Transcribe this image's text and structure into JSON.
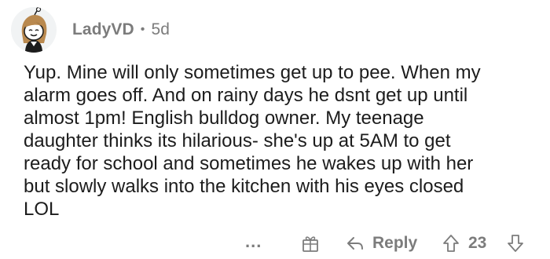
{
  "comment": {
    "author": "LadyVD",
    "separator": "•",
    "age": "5d",
    "body_lines": [
      "Yup. Mine will only sometimes get up to pee. When my",
      "alarm goes off. And on rainy days he dsnt get up until",
      "almost 1pm! English bulldog owner. My teenage",
      "daughter thinks its hilarious- she's up at 5AM to get",
      "ready for school and sometimes he wakes up with her",
      "but slowly walks into the kitchen with his eyes closed",
      "LOL"
    ]
  },
  "actions": {
    "more_label": "...",
    "reply_label": "Reply",
    "score": "23"
  },
  "icons": {
    "avatar": "snoo-avatar",
    "award": "gift-icon",
    "reply": "reply-arrow-icon",
    "upvote": "upvote-arrow-icon",
    "downvote": "downvote-arrow-icon"
  },
  "colors": {
    "meta_text": "#7c7c7c",
    "body_text": "#1c1c1c",
    "background": "#ffffff"
  }
}
